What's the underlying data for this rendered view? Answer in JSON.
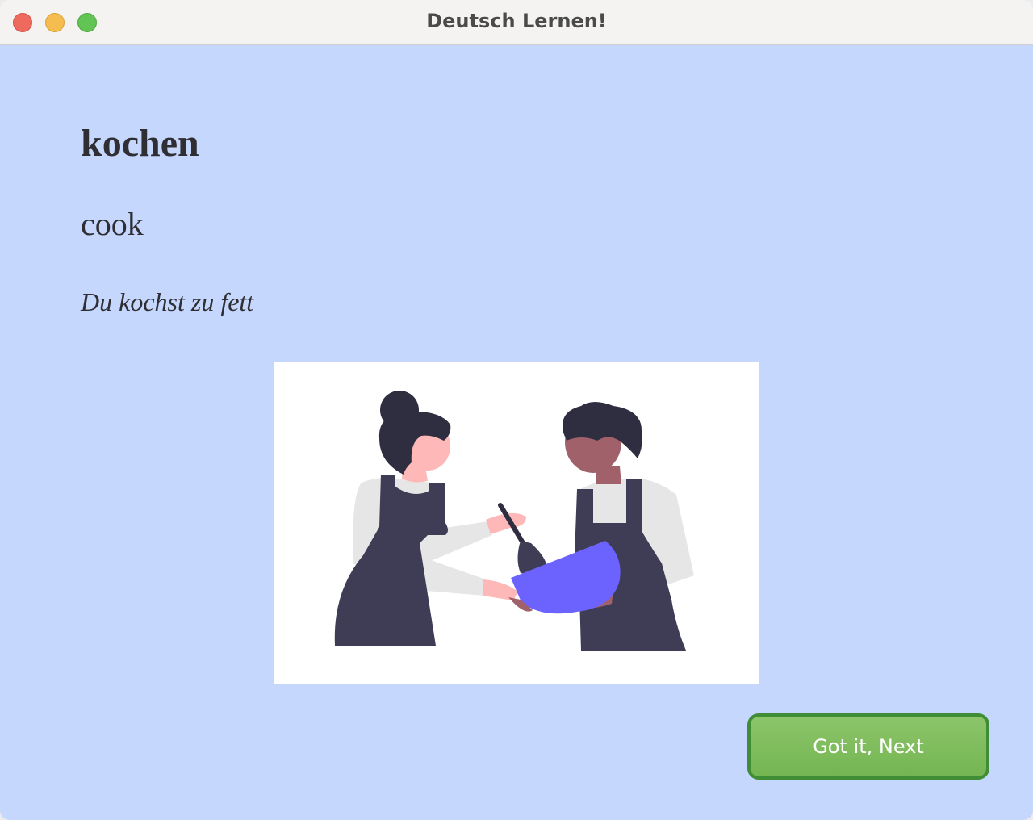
{
  "window": {
    "title": "Deutsch Lernen!"
  },
  "card": {
    "word": "kochen",
    "translation": "cook",
    "example": "Du kochst zu fett"
  },
  "illustration": {
    "subject": "two-people-cooking-illustration"
  },
  "actions": {
    "next_label": "Got it, Next"
  },
  "colors": {
    "background": "#c6d7fe",
    "button_fill": "#7dbb5c",
    "button_border": "#3f8e35",
    "bowl": "#6c63ff",
    "apron": "#3f3d56"
  }
}
